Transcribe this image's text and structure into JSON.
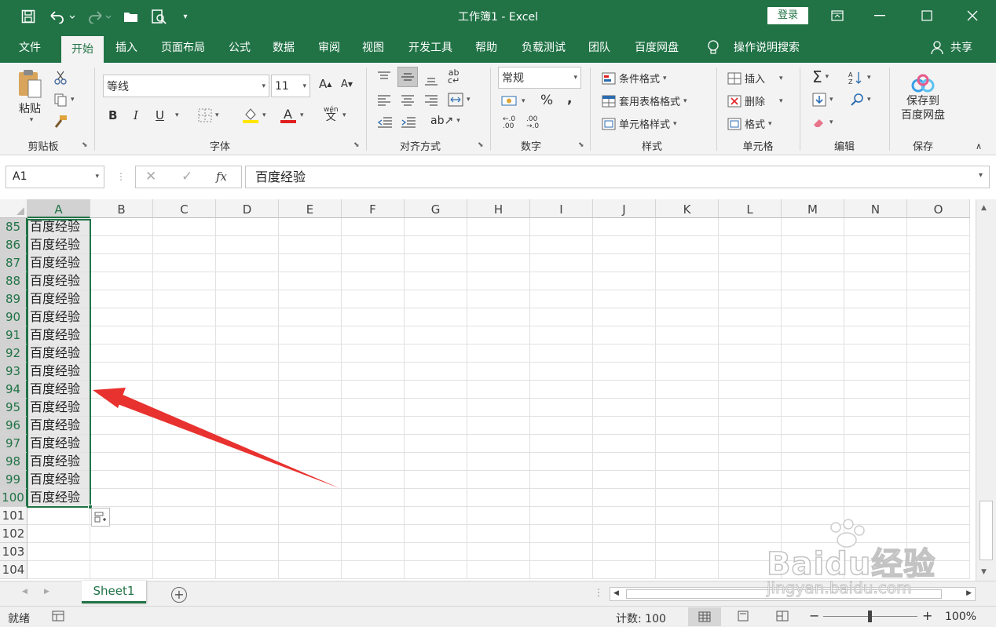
{
  "window": {
    "title": "工作簿1  -  Excel",
    "login_label": "登录"
  },
  "tabs": [
    "文件",
    "开始",
    "插入",
    "页面布局",
    "公式",
    "数据",
    "审阅",
    "视图",
    "开发工具",
    "帮助",
    "负载测试",
    "团队",
    "百度网盘"
  ],
  "search_label": "操作说明搜索",
  "share_label": "共享",
  "ribbon": {
    "clipboard": {
      "paste_label": "粘贴",
      "group_label": "剪贴板"
    },
    "font": {
      "font_name": "等线",
      "font_size": "11",
      "group_label": "字体",
      "bold": "B",
      "italic": "I",
      "underline": "U",
      "grow": "A",
      "shrink": "A",
      "phonetic": "wén"
    },
    "alignment": {
      "group_label": "对齐方式"
    },
    "number": {
      "format": "常规",
      "percent": "%",
      "comma": ",",
      "group_label": "数字",
      "inc_decimal": "←.0 .00",
      "dec_decimal": ".00 →.0"
    },
    "styles": {
      "conditional": "条件格式",
      "table": "套用表格格式",
      "cell_styles": "单元格样式",
      "group_label": "样式"
    },
    "cells": {
      "insert": "插入",
      "delete": "删除",
      "format": "格式",
      "group_label": "单元格"
    },
    "editing": {
      "group_label": "编辑",
      "sum": "Σ"
    },
    "save": {
      "label": "保存到\n百度网盘",
      "line1": "保存到",
      "line2": "百度网盘",
      "group_label": "保存"
    }
  },
  "formula_bar": {
    "name_box": "A1",
    "value": "百度经验",
    "fx": "fx"
  },
  "columns": [
    "A",
    "B",
    "C",
    "D",
    "E",
    "F",
    "G",
    "H",
    "I",
    "J",
    "K",
    "L",
    "M",
    "N",
    "O"
  ],
  "rows": [
    {
      "num": "85",
      "a": "百度经验"
    },
    {
      "num": "86",
      "a": "百度经验"
    },
    {
      "num": "87",
      "a": "百度经验"
    },
    {
      "num": "88",
      "a": "百度经验"
    },
    {
      "num": "89",
      "a": "百度经验"
    },
    {
      "num": "90",
      "a": "百度经验"
    },
    {
      "num": "91",
      "a": "百度经验"
    },
    {
      "num": "92",
      "a": "百度经验"
    },
    {
      "num": "93",
      "a": "百度经验"
    },
    {
      "num": "94",
      "a": "百度经验"
    },
    {
      "num": "95",
      "a": "百度经验"
    },
    {
      "num": "96",
      "a": "百度经验"
    },
    {
      "num": "97",
      "a": "百度经验"
    },
    {
      "num": "98",
      "a": "百度经验"
    },
    {
      "num": "99",
      "a": "百度经验"
    },
    {
      "num": "100",
      "a": "百度经验"
    },
    {
      "num": "101",
      "a": ""
    },
    {
      "num": "102",
      "a": ""
    },
    {
      "num": "103",
      "a": ""
    },
    {
      "num": "104",
      "a": ""
    }
  ],
  "sheet_tab": "Sheet1",
  "status": {
    "ready": "就绪",
    "count": "计数: 100",
    "zoom": "100%"
  },
  "watermark": {
    "brand": "Baidu经验",
    "url": "jingyan.baidu.com"
  },
  "colors": {
    "excel_green": "#217346",
    "annotation_arrow": "#e8322f"
  }
}
